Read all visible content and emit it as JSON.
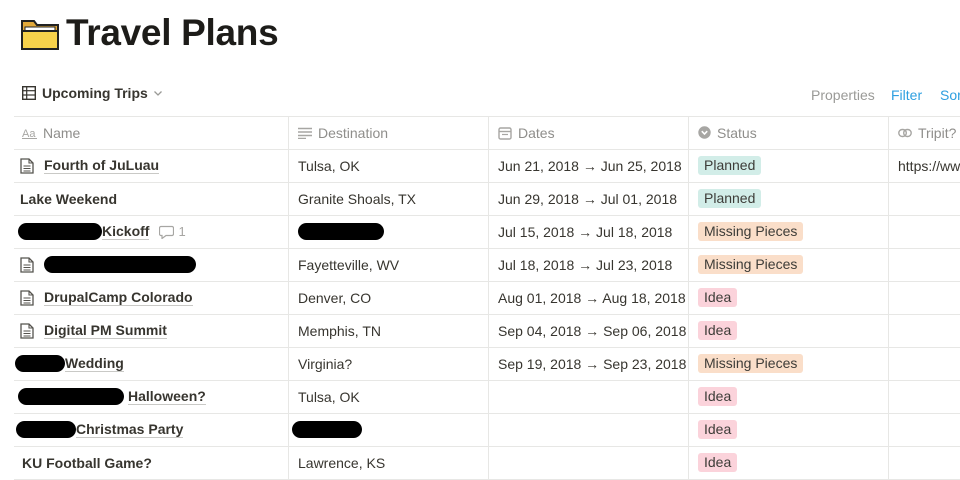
{
  "page": {
    "title": "Travel Plans",
    "icon": "folder-icon"
  },
  "toolbar": {
    "view_name": "Upcoming Trips",
    "properties": "Properties",
    "filter": "Filter",
    "sort": "Sor"
  },
  "columns": {
    "name": "Name",
    "destination": "Destination",
    "dates": "Dates",
    "status": "Status",
    "tripit": "Tripit?"
  },
  "status_colors": {
    "Planned": "#d2ede8",
    "Missing Pieces": "#fadec9",
    "Idea": "#fbd3db"
  },
  "rows": [
    {
      "name": "Fourth of JuLuau",
      "destination": "Tulsa, OK",
      "dates": "Jun 21, 2018 → Jun 25, 2018",
      "status": "Planned",
      "tripit": "https://ww"
    },
    {
      "name": "Lake Weekend",
      "destination": "Granite Shoals, TX",
      "dates": "Jun 29, 2018 → Jul 01, 2018",
      "status": "Planned",
      "tripit": ""
    },
    {
      "name": "Kickoff",
      "destination": "",
      "dates": "Jul 15, 2018 → Jul 18, 2018",
      "status": "Missing Pieces",
      "tripit": "",
      "comments": "1"
    },
    {
      "name": "",
      "destination": "Fayetteville, WV",
      "dates": "Jul 18, 2018 → Jul 23, 2018",
      "status": "Missing Pieces",
      "tripit": ""
    },
    {
      "name": "DrupalCamp Colorado",
      "destination": "Denver, CO",
      "dates": "Aug 01, 2018 → Aug 18, 2018",
      "status": "Idea",
      "tripit": ""
    },
    {
      "name": "Digital PM Summit",
      "destination": "Memphis, TN",
      "dates": "Sep 04, 2018 → Sep 06, 2018",
      "status": "Idea",
      "tripit": ""
    },
    {
      "name": "Wedding",
      "destination": "Virginia?",
      "dates": "Sep 19, 2018 → Sep 23, 2018",
      "status": "Missing Pieces",
      "tripit": ""
    },
    {
      "name": "Halloween?",
      "destination": "Tulsa, OK",
      "dates": "",
      "status": "Idea",
      "tripit": ""
    },
    {
      "name": "Christmas Party",
      "destination": "",
      "dates": "",
      "status": "Idea",
      "tripit": ""
    },
    {
      "name": "KU Football Game?",
      "destination": "Lawrence, KS",
      "dates": "",
      "status": "Idea",
      "tripit": ""
    }
  ]
}
